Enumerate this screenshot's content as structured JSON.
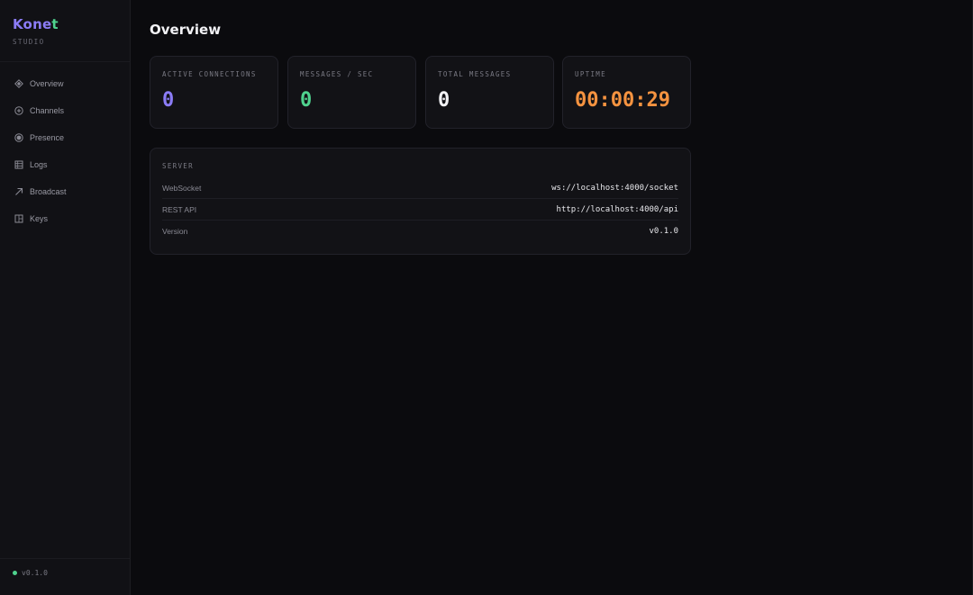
{
  "brand": {
    "name_part1": "Kone",
    "name_part2": "t",
    "subtitle": "STUDIO"
  },
  "sidebar": {
    "items": [
      {
        "label": "Overview",
        "icon": "diamond-icon"
      },
      {
        "label": "Channels",
        "icon": "channels-icon"
      },
      {
        "label": "Presence",
        "icon": "presence-icon"
      },
      {
        "label": "Logs",
        "icon": "logs-icon"
      },
      {
        "label": "Broadcast",
        "icon": "broadcast-icon"
      },
      {
        "label": "Keys",
        "icon": "keys-icon"
      }
    ],
    "footer": {
      "version": "v0.1.0",
      "status_color": "#4fd28e"
    }
  },
  "page": {
    "title": "Overview"
  },
  "stats": [
    {
      "label": "ACTIVE CONNECTIONS",
      "value": "0",
      "color": "#8b7cf6"
    },
    {
      "label": "MESSAGES / SEC",
      "value": "0",
      "color": "#4fd28e"
    },
    {
      "label": "TOTAL MESSAGES",
      "value": "0",
      "color": "#f2f2f5"
    },
    {
      "label": "UPTIME",
      "value": "00:00:29",
      "color": "#f59340"
    }
  ],
  "server": {
    "title": "SERVER",
    "rows": [
      {
        "key": "WebSocket",
        "value": "ws://localhost:4000/socket"
      },
      {
        "key": "REST API",
        "value": "http://localhost:4000/api"
      },
      {
        "key": "Version",
        "value": "v0.1.0"
      }
    ]
  }
}
